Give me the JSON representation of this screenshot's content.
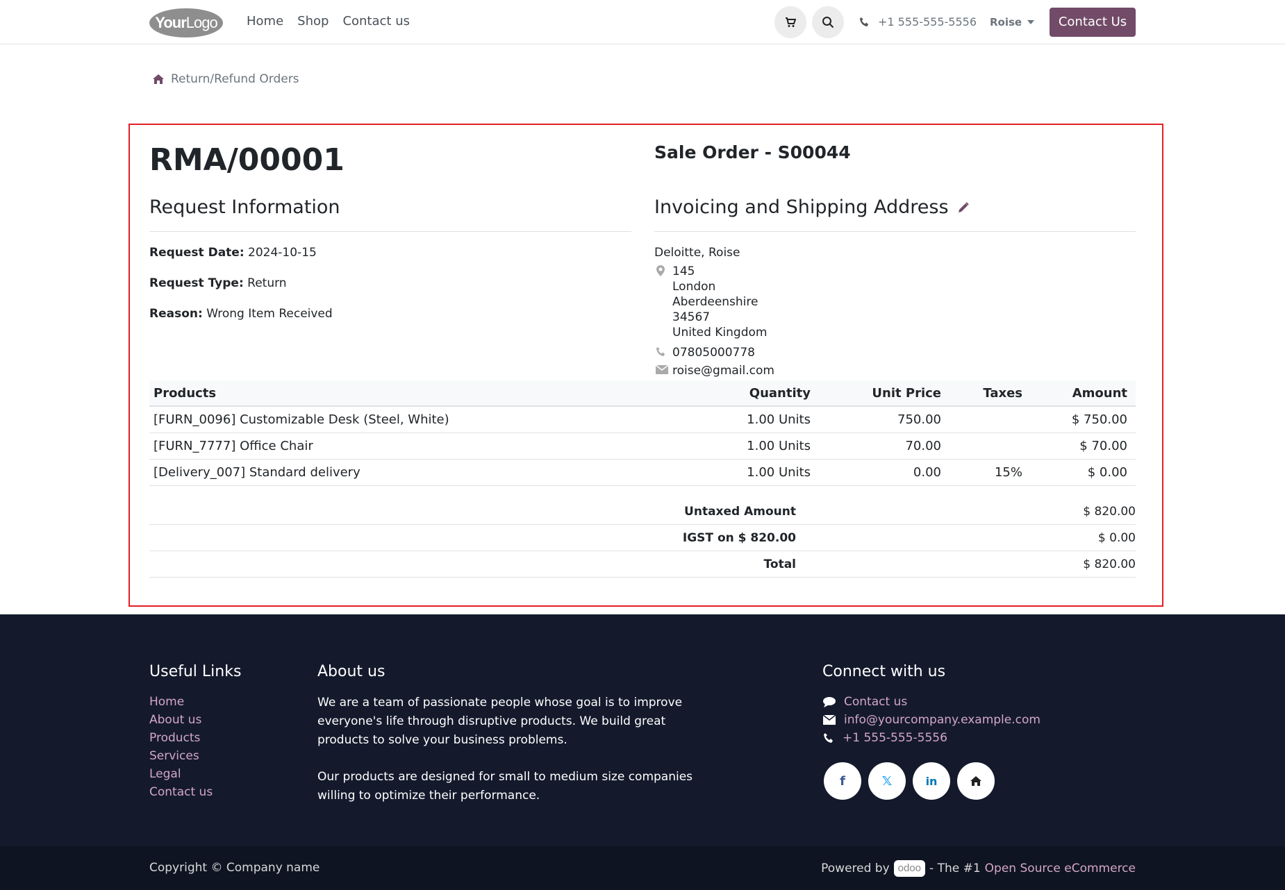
{
  "header": {
    "logo_text_bold": "Your",
    "logo_text_light": "Logo",
    "nav": [
      "Home",
      "Shop",
      "Contact us"
    ],
    "phone": "+1 555-555-5556",
    "user": "Roise",
    "contact_button": "Contact Us"
  },
  "breadcrumb": "Return/Refund Orders",
  "rma": {
    "title": "RMA/00001",
    "sale_order": "Sale Order - S00044",
    "request_info_title": "Request Information",
    "request_date_label": "Request Date:",
    "request_date": "2024-10-15",
    "request_type_label": "Request Type:",
    "request_type": "Return",
    "reason_label": "Reason:",
    "reason": "Wrong Item Received",
    "address_title": "Invoicing and Shipping Address",
    "address": {
      "name": "Deloitte, Roise",
      "street": "145",
      "city": "London",
      "state": "Aberdeenshire",
      "zip": "34567",
      "country": "United Kingdom",
      "phone": "07805000778",
      "email": "roise@gmail.com"
    }
  },
  "table": {
    "headers": [
      "Products",
      "Quantity",
      "Unit Price",
      "Taxes",
      "Amount"
    ],
    "rows": [
      [
        "[FURN_0096] Customizable Desk (Steel, White)",
        "1.00 Units",
        "750.00",
        "",
        "$ 750.00"
      ],
      [
        "[FURN_7777] Office Chair",
        "1.00 Units",
        "70.00",
        "",
        "$ 70.00"
      ],
      [
        "[Delivery_007] Standard delivery",
        "1.00 Units",
        "0.00",
        "15%",
        "$ 0.00"
      ]
    ]
  },
  "totals": [
    {
      "label": "Untaxed Amount",
      "value": "$ 820.00"
    },
    {
      "label": "IGST on $ 820.00",
      "value": "$ 0.00"
    },
    {
      "label": "Total",
      "value": "$ 820.00"
    }
  ],
  "footer": {
    "useful_links_title": "Useful Links",
    "useful_links": [
      "Home",
      "About us",
      "Products",
      "Services",
      "Legal",
      "Contact us"
    ],
    "about_title": "About us",
    "about_p1": "We are a team of passionate people whose goal is to improve everyone's life through disruptive products. We build great products to solve your business problems.",
    "about_p2": "Our products are designed for small to medium size companies willing to optimize their performance.",
    "connect_title": "Connect with us",
    "connect_contact": "Contact us",
    "connect_email": "info@yourcompany.example.com",
    "connect_phone": "+1 555-555-5556",
    "social": [
      "facebook-icon",
      "x-icon",
      "linkedin-icon",
      "home-icon"
    ]
  },
  "copyright": {
    "left": "Copyright © Company name",
    "powered_by": "Powered by",
    "odoo": "odoo",
    "the1": "- The #1",
    "link": "Open Source eCommerce"
  },
  "colors": {
    "brand": "#714b67",
    "highlight_border": "#e31e24",
    "footer_bg": "#141a2c",
    "footer_link": "#d3a6c7"
  }
}
